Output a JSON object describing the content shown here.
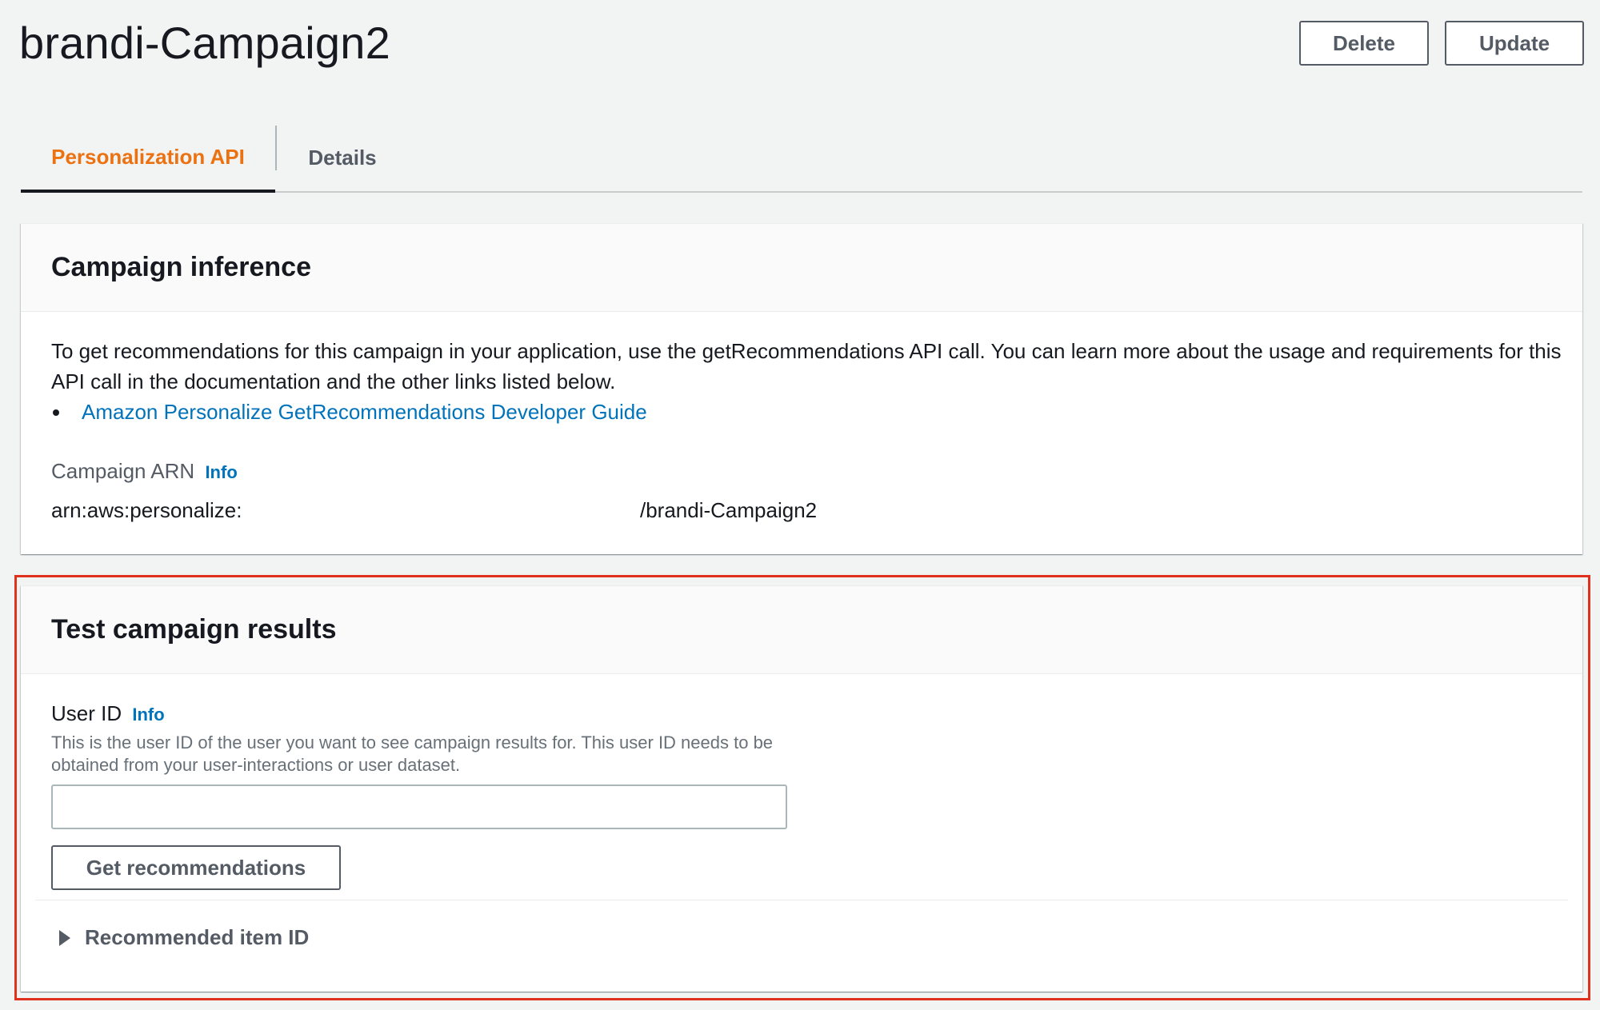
{
  "page": {
    "title": "brandi-Campaign2",
    "actions": {
      "delete_label": "Delete",
      "update_label": "Update"
    }
  },
  "tabs": [
    {
      "label": "Personalization API",
      "active": true
    },
    {
      "label": "Details",
      "active": false
    }
  ],
  "inference_panel": {
    "title": "Campaign inference",
    "description": "To get recommendations for this campaign in your application, use the getRecommendations API call. You can learn more about the usage and requirements for this API call in the documentation and the other links listed below.",
    "links": [
      {
        "label": "Amazon Personalize GetRecommendations Developer Guide"
      }
    ],
    "arn": {
      "label": "Campaign ARN",
      "info_label": "Info",
      "value_prefix": "arn:aws:personalize:",
      "value_suffix": "/brandi-Campaign2"
    }
  },
  "test_panel": {
    "title": "Test campaign results",
    "user_id": {
      "label": "User ID",
      "info_label": "Info",
      "description": "This is the user ID of the user you want to see campaign results for. This user ID needs to be obtained from your user-interactions or user dataset.",
      "value": "",
      "placeholder": ""
    },
    "button_label": "Get recommendations",
    "expandable_label": "Recommended item ID"
  },
  "colors": {
    "accent_active_tab": "#ec7211",
    "link": "#0073bb",
    "highlight_border": "#e0301e"
  },
  "icons": {
    "expand": "caret-right-icon"
  }
}
